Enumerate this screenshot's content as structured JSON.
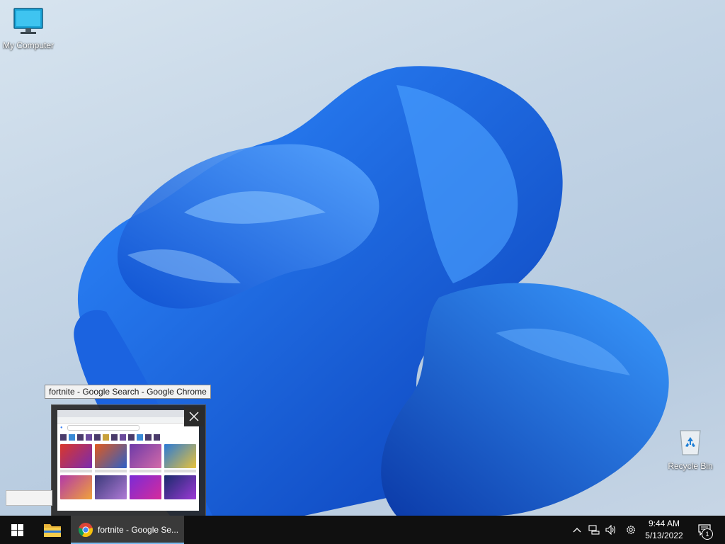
{
  "desktop": {
    "icons": [
      {
        "label": "My Computer",
        "icon": "monitor-icon"
      },
      {
        "label": "Recycle Bin",
        "icon": "recycle-bin-icon"
      }
    ]
  },
  "tooltip": {
    "text": "fortnite - Google Search - Google Chrome"
  },
  "preview": {
    "close_icon": "close-icon"
  },
  "taskbar": {
    "start_icon": "windows-logo-icon",
    "explorer_icon": "folder-icon",
    "chrome_window_label": "fortnite - Google Se...",
    "accent": "#76b9ed"
  },
  "tray": {
    "icons": [
      "chevron-up-icon",
      "network-icon",
      "volume-icon",
      "settings-icon"
    ],
    "time": "9:44 AM",
    "date": "5/13/2022",
    "notification_count": "1"
  }
}
